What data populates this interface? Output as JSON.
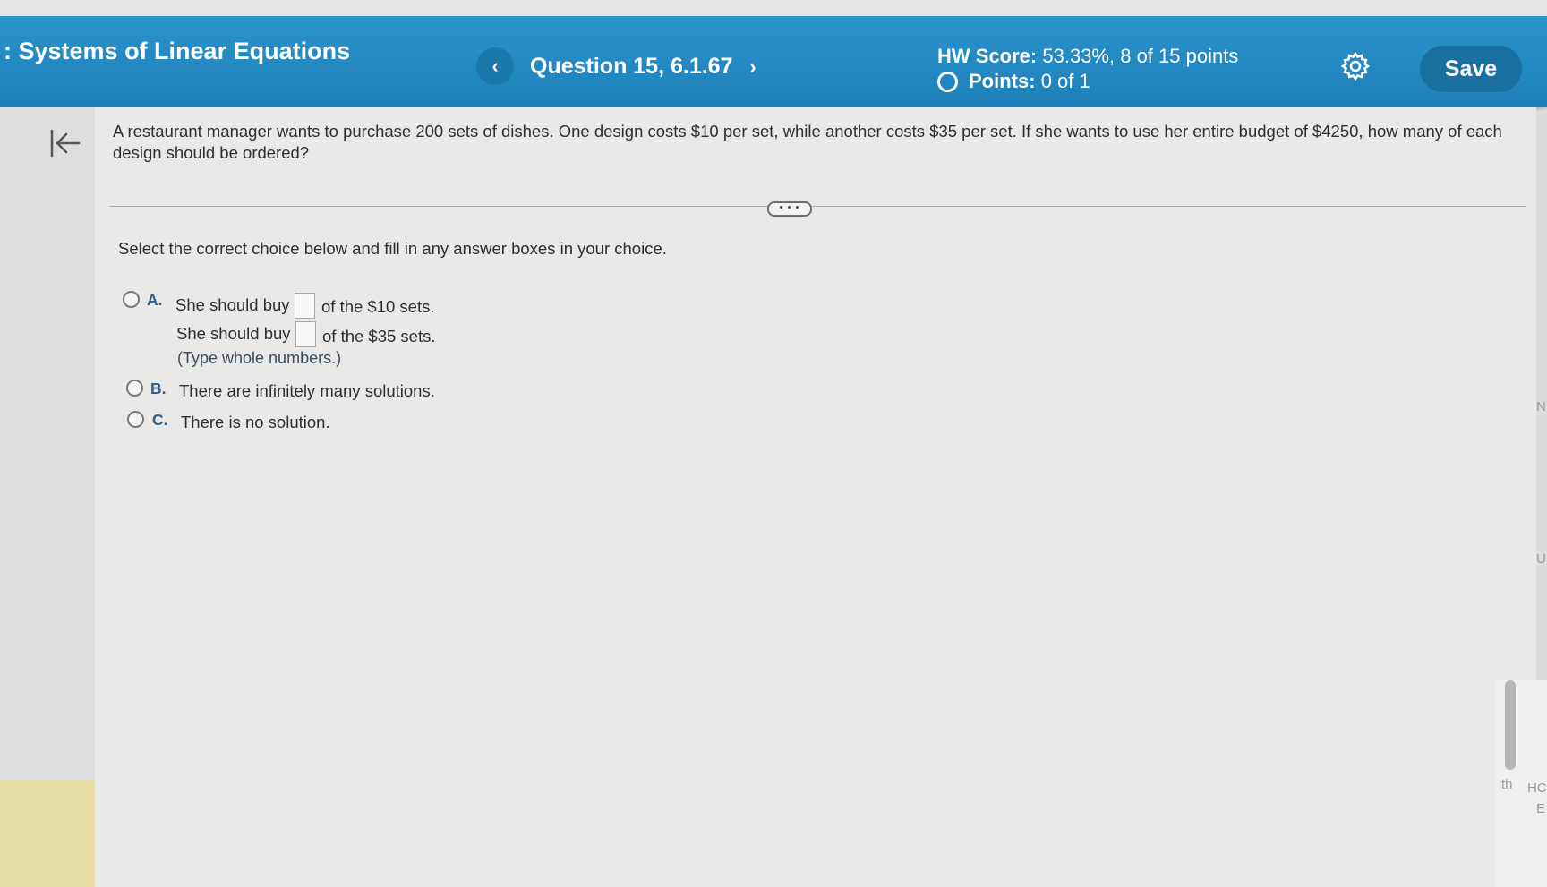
{
  "header": {
    "assignment_title": ": Systems of Linear Equations",
    "question_title": "Question 15, 6.1.67",
    "prev_icon": "‹",
    "next_icon": "›",
    "hw_score_label": "HW Score:",
    "hw_score_value": "53.33%, 8 of 15 points",
    "points_label": "Points:",
    "points_value": "0 of 1",
    "save_label": "Save"
  },
  "question": {
    "text": "A restaurant manager wants to purchase 200 sets of dishes. One design costs $10 per set, while another costs $35 per set. If she wants to use her entire budget of $4250, how many of each design should be ordered?",
    "expand_label": "• • •"
  },
  "answer": {
    "instruction": "Select the correct choice below and fill in any answer boxes in your choice.",
    "choice_a": {
      "letter": "A.",
      "line1_pre": "She should buy",
      "line1_post": "of the $10 sets.",
      "line2_pre": "She should buy",
      "line2_post": "of the $35 sets.",
      "note": "(Type whole numbers.)"
    },
    "choice_b": {
      "letter": "B.",
      "text": "There are infinitely many solutions."
    },
    "choice_c": {
      "letter": "C.",
      "text": "There is no solution."
    }
  },
  "edge": {
    "t1": "th",
    "t2": "HC",
    "t3": "E",
    "t4": "U",
    "t5": "N"
  },
  "colors": {
    "header": "#1e80b9",
    "save_button": "#1a6fa1",
    "choice_letter": "#2f5e8c"
  },
  "icons": [
    "chevron-left-icon",
    "chevron-right-icon",
    "gear-icon",
    "collapse-panel-icon",
    "radio-circle-icon"
  ]
}
